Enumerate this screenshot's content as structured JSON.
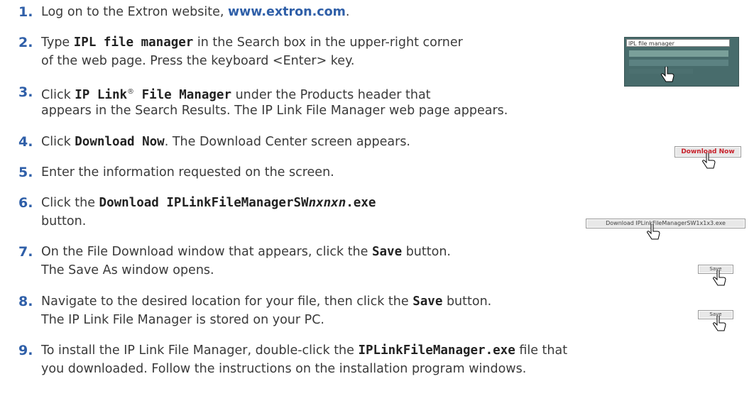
{
  "steps": [
    {
      "num": "1.",
      "a": "Log on to the Extron website, ",
      "link": "www.extron.com",
      "b": "."
    },
    {
      "num": "2.",
      "a": "Type ",
      "code": "IPL file manager",
      "b": " in the Search box in the upper-right corner",
      "l2": "of the web page. Press the keyboard <Enter> key."
    },
    {
      "num": "3.",
      "a": "Click ",
      "code": "IP Link",
      "reg": "®",
      "code2": " File Manager",
      "b": " under the Products header that",
      "l2": "appears in the Search Results. The IP Link File Manager web page appears."
    },
    {
      "num": "4.",
      "a": "Click ",
      "code": "Download Now",
      "b": ". The Download Center screen appears."
    },
    {
      "num": "5.",
      "a": "Enter the information requested on the screen."
    },
    {
      "num": "6.",
      "a": "Click the ",
      "code": "Download IPLinkFileManagerSW",
      "var": "nxnxn",
      "code2": ".exe",
      "l2": "button."
    },
    {
      "num": "7.",
      "a": "On the File Download window that appears, click the ",
      "code": "Save",
      "b": " button.",
      "l2": "The Save As window opens."
    },
    {
      "num": "8.",
      "a": "Navigate to the desired location for your file, then click the ",
      "code": "Save",
      "b": " button.",
      "l2": "The IP Link File Manager is stored on your PC."
    },
    {
      "num": "9.",
      "a": "To install the IP Link File Manager, double-click the ",
      "code": "IPLinkFileManager.exe",
      "b": " file that",
      "l2": "you downloaded. Follow the instructions on the installation program windows."
    }
  ],
  "thumbs": {
    "search_text": "IPL file manager",
    "download_now": "Download Now",
    "download_file": "Download IPLinkFileManagerSW1x1x3.exe",
    "save": "Save"
  },
  "colors": {
    "step_number": "#2f5fa8",
    "link": "#2f5fa8",
    "download_now": "#c8202a"
  }
}
